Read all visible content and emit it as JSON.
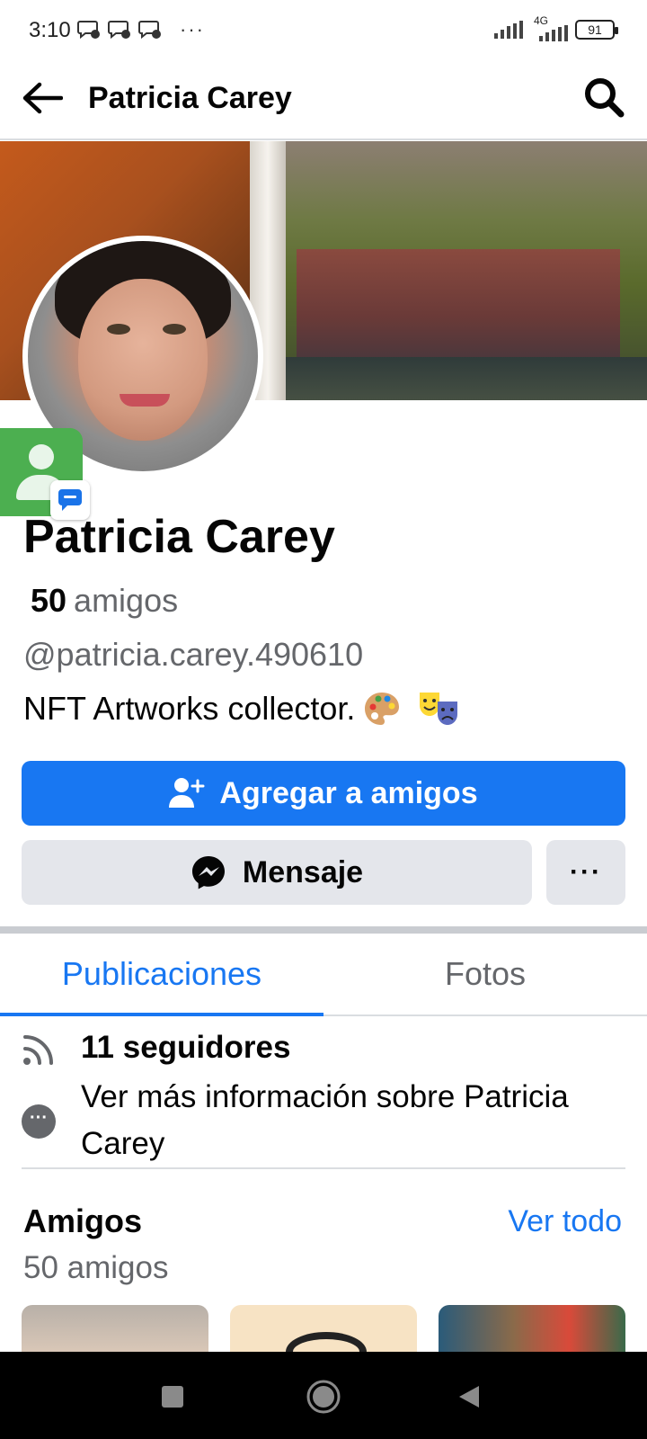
{
  "status_bar": {
    "time": "3:10",
    "more": "···",
    "network": "4G",
    "battery": "91"
  },
  "header": {
    "title": "Patricia Carey"
  },
  "profile": {
    "name": "Patricia Carey",
    "friends_count": "50",
    "friends_word": "amigos",
    "username": "@patricia.carey.490610",
    "bio": "NFT  Artworks collector."
  },
  "actions": {
    "add_friend": "Agregar a amigos",
    "message": "Mensaje",
    "more": "···"
  },
  "tabs": [
    {
      "label": "Publicaciones",
      "active": true
    },
    {
      "label": "Fotos",
      "active": false
    }
  ],
  "info": {
    "followers": "11 seguidores",
    "more_info": "Ver más información sobre Patricia Carey"
  },
  "friends_section": {
    "title": "Amigos",
    "see_all": "Ver todo",
    "count": "50 amigos"
  },
  "colors": {
    "accent": "#1877f2",
    "secondary_button": "#e4e6eb",
    "muted_text": "#65676b"
  }
}
